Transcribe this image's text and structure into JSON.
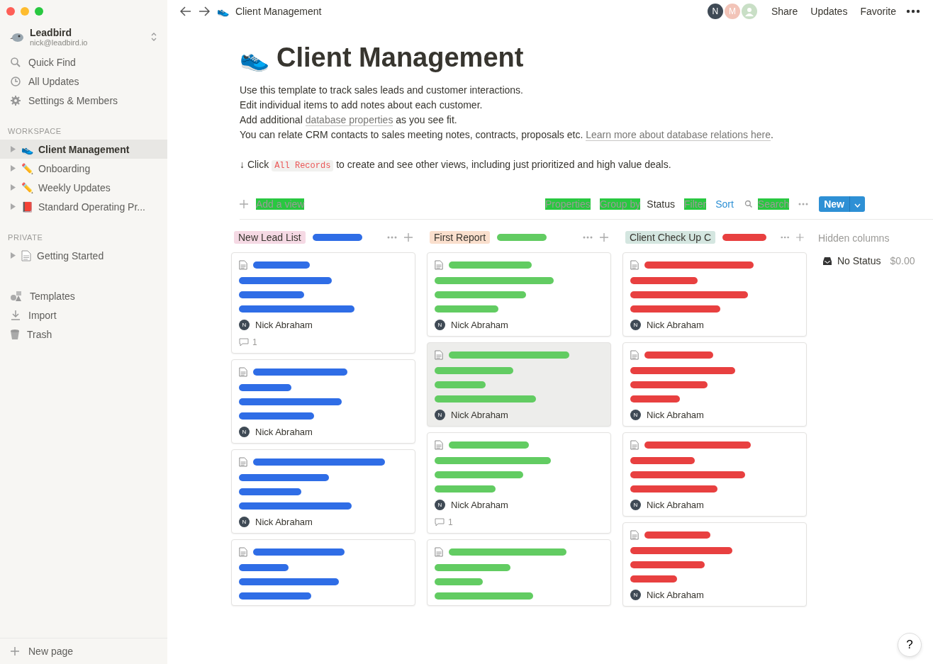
{
  "sidebar": {
    "workspace": {
      "name": "Leadbird",
      "email": "nick@leadbird.io"
    },
    "actions": [
      {
        "kind": "search",
        "label": "Quick Find"
      },
      {
        "kind": "clock",
        "label": "All Updates"
      },
      {
        "kind": "gear",
        "label": "Settings & Members"
      }
    ],
    "sections": [
      {
        "title": "WORKSPACE",
        "pages": [
          {
            "kind": "emoji",
            "icon": "👟",
            "label": "Client Management",
            "selected": true
          },
          {
            "kind": "emoji",
            "icon": "✏️",
            "label": "Onboarding",
            "selected": false
          },
          {
            "kind": "emoji",
            "icon": "✏️",
            "label": "Weekly Updates",
            "selected": false
          },
          {
            "kind": "emoji",
            "icon": "📕",
            "label": "Standard Operating Pr...",
            "selected": false
          }
        ]
      },
      {
        "title": "PRIVATE",
        "pages": [
          {
            "kind": "document",
            "label": "Getting Started",
            "selected": false
          }
        ]
      }
    ],
    "tools": [
      {
        "kind": "shapes",
        "label": "Templates"
      },
      {
        "kind": "download",
        "label": "Import"
      },
      {
        "kind": "trash",
        "label": "Trash"
      }
    ],
    "new_page": "New page"
  },
  "topbar": {
    "icon": "👟",
    "breadcrumb": "Client Management",
    "avatars": [
      {
        "initial": "N",
        "color": "#3f4a55"
      },
      {
        "initial": "M",
        "color": "#f2c4b8"
      },
      {
        "color": "#c9dfc6"
      }
    ],
    "actions": [
      "Share",
      "Updates",
      "Favorite"
    ]
  },
  "page": {
    "icon": "👟",
    "title": "Client Management",
    "lines": [
      "Use this template to track sales leads and customer interactions.",
      "Edit individual items to add notes about each customer."
    ],
    "line3": {
      "before": "Add additional ",
      "link": "database properties",
      "after": " as you see fit."
    },
    "line4": {
      "before": "You can relate CRM contacts to sales meeting notes, contracts, proposals etc. ",
      "link": "Learn more about database relations here",
      "after": "."
    },
    "hint": {
      "before": "↓ Click ",
      "code": "All Records",
      "after": " to create and see other views, including just prioritized and high value deals."
    }
  },
  "toolbar": {
    "add_view": "Add a view",
    "properties": "Properties",
    "group_by": "Group by",
    "group_value": "Status",
    "filter": "Filter",
    "sort": "Sort",
    "search": "Search",
    "new": "New"
  },
  "board": {
    "columns": [
      {
        "title": "New Lead List",
        "color": "#f5d9e4",
        "cards": [
          {
            "initial": "N",
            "owner": "Nick Abraham",
            "comments": "1",
            "hovered": false
          },
          {
            "initial": "N",
            "owner": "Nick Abraham",
            "hovered": false
          },
          {
            "initial": "N",
            "owner": "Nick Abraham",
            "hovered": false
          },
          {
            "hovered": false
          }
        ]
      },
      {
        "title": "First Report",
        "color": "#fadfcd",
        "cards": [
          {
            "initial": "N",
            "owner": "Nick Abraham",
            "hovered": false
          },
          {
            "initial": "N",
            "owner": "Nick Abraham",
            "hovered": true
          },
          {
            "initial": "N",
            "owner": "Nick Abraham",
            "comments": "1",
            "hovered": false
          },
          {
            "hovered": false
          }
        ]
      },
      {
        "title": "Client Check Up C",
        "color": "#d4e6e0",
        "cards": [
          {
            "initial": "N",
            "owner": "Nick Abraham",
            "hovered": false
          },
          {
            "initial": "N",
            "owner": "Nick Abraham",
            "hovered": false
          },
          {
            "initial": "N",
            "owner": "Nick Abraham",
            "hovered": false
          },
          {
            "initial": "N",
            "owner": "Nick Abraham",
            "hovered": false
          }
        ]
      }
    ],
    "hidden": {
      "title": "Hidden columns",
      "label": "No Status",
      "amount": "$0.00"
    }
  },
  "help": "?"
}
